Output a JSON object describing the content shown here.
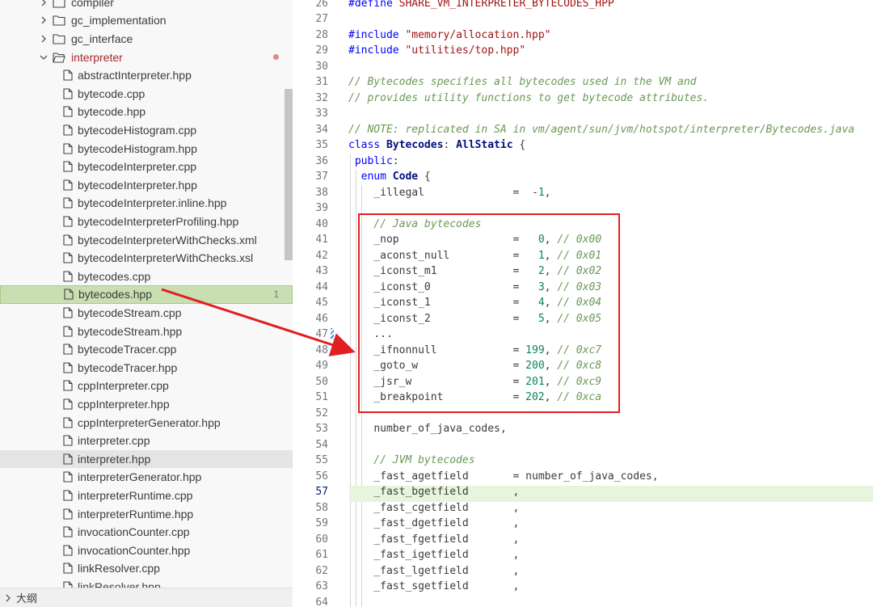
{
  "explorer": {
    "items": [
      {
        "kind": "folder",
        "label": "compiler",
        "expanded": false
      },
      {
        "kind": "folder",
        "label": "gc_implementation",
        "expanded": false
      },
      {
        "kind": "folder",
        "label": "gc_interface",
        "expanded": false
      },
      {
        "kind": "folder",
        "label": "interpreter",
        "expanded": true
      },
      {
        "kind": "file",
        "label": "abstractInterpreter.hpp"
      },
      {
        "kind": "file",
        "label": "bytecode.cpp"
      },
      {
        "kind": "file",
        "label": "bytecode.hpp"
      },
      {
        "kind": "file",
        "label": "bytecodeHistogram.cpp"
      },
      {
        "kind": "file",
        "label": "bytecodeHistogram.hpp"
      },
      {
        "kind": "file",
        "label": "bytecodeInterpreter.cpp"
      },
      {
        "kind": "file",
        "label": "bytecodeInterpreter.hpp"
      },
      {
        "kind": "file",
        "label": "bytecodeInterpreter.inline.hpp"
      },
      {
        "kind": "file",
        "label": "bytecodeInterpreterProfiling.hpp"
      },
      {
        "kind": "file",
        "label": "bytecodeInterpreterWithChecks.xml"
      },
      {
        "kind": "file",
        "label": "bytecodeInterpreterWithChecks.xsl"
      },
      {
        "kind": "file",
        "label": "bytecodes.cpp"
      },
      {
        "kind": "file",
        "label": "bytecodes.hpp",
        "selected": true,
        "badge": "1"
      },
      {
        "kind": "file",
        "label": "bytecodeStream.cpp"
      },
      {
        "kind": "file",
        "label": "bytecodeStream.hpp"
      },
      {
        "kind": "file",
        "label": "bytecodeTracer.cpp"
      },
      {
        "kind": "file",
        "label": "bytecodeTracer.hpp"
      },
      {
        "kind": "file",
        "label": "cppInterpreter.cpp"
      },
      {
        "kind": "file",
        "label": "cppInterpreter.hpp"
      },
      {
        "kind": "file",
        "label": "cppInterpreterGenerator.hpp"
      },
      {
        "kind": "file",
        "label": "interpreter.cpp"
      },
      {
        "kind": "file",
        "label": "interpreter.hpp",
        "hover": true
      },
      {
        "kind": "file",
        "label": "interpreterGenerator.hpp"
      },
      {
        "kind": "file",
        "label": "interpreterRuntime.cpp"
      },
      {
        "kind": "file",
        "label": "interpreterRuntime.hpp"
      },
      {
        "kind": "file",
        "label": "invocationCounter.cpp"
      },
      {
        "kind": "file",
        "label": "invocationCounter.hpp"
      },
      {
        "kind": "file",
        "label": "linkResolver.cpp"
      },
      {
        "kind": "file",
        "label": "linkResolver.hpp"
      }
    ],
    "outline_label": "大纲"
  },
  "editor": {
    "lines": [
      {
        "n": "26",
        "code": "#define SHARE_VM_INTERPRETER_BYTECODES_HPP"
      },
      {
        "n": "27",
        "code": ""
      },
      {
        "n": "28",
        "code": "#include \"memory/allocation.hpp\""
      },
      {
        "n": "29",
        "code": "#include \"utilities/top.hpp\""
      },
      {
        "n": "30",
        "code": ""
      },
      {
        "n": "31",
        "code": "// Bytecodes specifies all bytecodes used in the VM and"
      },
      {
        "n": "32",
        "code": "// provides utility functions to get bytecode attributes."
      },
      {
        "n": "33",
        "code": ""
      },
      {
        "n": "34",
        "code": "// NOTE: replicated in SA in vm/agent/sun/jvm/hotspot/interpreter/Bytecodes.java"
      },
      {
        "n": "35",
        "code": "class Bytecodes: AllStatic {"
      },
      {
        "n": "36",
        "code": " public:"
      },
      {
        "n": "37",
        "code": "  enum Code {"
      },
      {
        "n": "38",
        "code": "    _illegal              =  -1,"
      },
      {
        "n": "39",
        "code": ""
      },
      {
        "n": "40",
        "code": "    // Java bytecodes"
      },
      {
        "n": "41",
        "code": "    _nop                  =   0, // 0x00"
      },
      {
        "n": "42",
        "code": "    _aconst_null          =   1, // 0x01"
      },
      {
        "n": "43",
        "code": "    _iconst_m1            =   2, // 0x02"
      },
      {
        "n": "44",
        "code": "    _iconst_0             =   3, // 0x03"
      },
      {
        "n": "45",
        "code": "    _iconst_1             =   4, // 0x04"
      },
      {
        "n": "46",
        "code": "    _iconst_2             =   5, // 0x05"
      },
      {
        "n": "47",
        "code": "    ..."
      },
      {
        "n": "48",
        "code": "    _ifnonnull            = 199, // 0xc7"
      },
      {
        "n": "49",
        "code": "    _goto_w               = 200, // 0xc8"
      },
      {
        "n": "50",
        "code": "    _jsr_w                = 201, // 0xc9"
      },
      {
        "n": "51",
        "code": "    _breakpoint           = 202, // 0xca"
      },
      {
        "n": "52",
        "code": ""
      },
      {
        "n": "53",
        "code": "    number_of_java_codes,"
      },
      {
        "n": "54",
        "code": ""
      },
      {
        "n": "55",
        "code": "    // JVM bytecodes"
      },
      {
        "n": "56",
        "code": "    _fast_agetfield       = number_of_java_codes,"
      },
      {
        "n": "57",
        "code": "    _fast_bgetfield       ,",
        "highlight": true
      },
      {
        "n": "58",
        "code": "    _fast_cgetfield       ,"
      },
      {
        "n": "59",
        "code": "    _fast_dgetfield       ,"
      },
      {
        "n": "60",
        "code": "    _fast_fgetfield       ,"
      },
      {
        "n": "61",
        "code": "    _fast_igetfield       ,"
      },
      {
        "n": "62",
        "code": "    _fast_lgetfield       ,"
      },
      {
        "n": "63",
        "code": "    _fast_sgetfield       ,"
      },
      {
        "n": "64",
        "code": ""
      }
    ]
  },
  "colors": {
    "annotation_red": "#e02020",
    "selected_row": "#c9dfb1",
    "current_line": "#e6f5dc"
  }
}
